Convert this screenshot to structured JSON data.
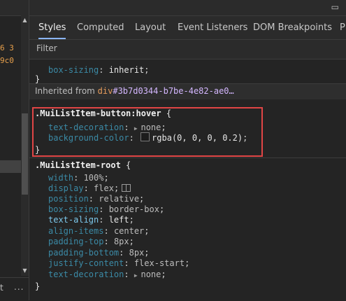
{
  "left": {
    "code_lines": [
      "6 3",
      "9c0"
    ],
    "bottom_text": "t",
    "more": "..."
  },
  "tabs": [
    "Styles",
    "Computed",
    "Layout",
    "Event Listeners",
    "DOM Breakpoints",
    "P"
  ],
  "filter": {
    "placeholder": "Filter"
  },
  "top_rule": {
    "prop": "box-sizing",
    "value": "inherit"
  },
  "inherited": {
    "label": "Inherited from ",
    "tag": "div",
    "id": "#3b7d0344-b7be-4e82-ae0…"
  },
  "hover_rule": {
    "selector": ".MuiListItem-button:hover",
    "declarations": [
      {
        "prop": "text-decoration",
        "value": "none"
      },
      {
        "prop": "background-color",
        "value": "rgba(0, 0, 0, 0.2)"
      }
    ]
  },
  "root_rule": {
    "selector": ".MuiListItem-root",
    "declarations": [
      {
        "prop": "width",
        "value": "100%"
      },
      {
        "prop": "display",
        "value": "flex"
      },
      {
        "prop": "position",
        "value": "relative"
      },
      {
        "prop": "box-sizing",
        "value": "border-box"
      },
      {
        "prop": "text-align",
        "value": "left"
      },
      {
        "prop": "align-items",
        "value": "center"
      },
      {
        "prop": "padding-top",
        "value": "8px"
      },
      {
        "prop": "padding-bottom",
        "value": "8px"
      },
      {
        "prop": "justify-content",
        "value": "flex-start"
      },
      {
        "prop": "text-decoration",
        "value": "none"
      }
    ]
  },
  "punctuation": {
    "open": " {",
    "close": "}",
    "colon": ": ",
    "semi": ";"
  },
  "colors": {
    "highlight_border": "#e04545",
    "active_tab": "#8ab4f8",
    "property": "#5db0d7",
    "link": "#d4b7ff"
  }
}
